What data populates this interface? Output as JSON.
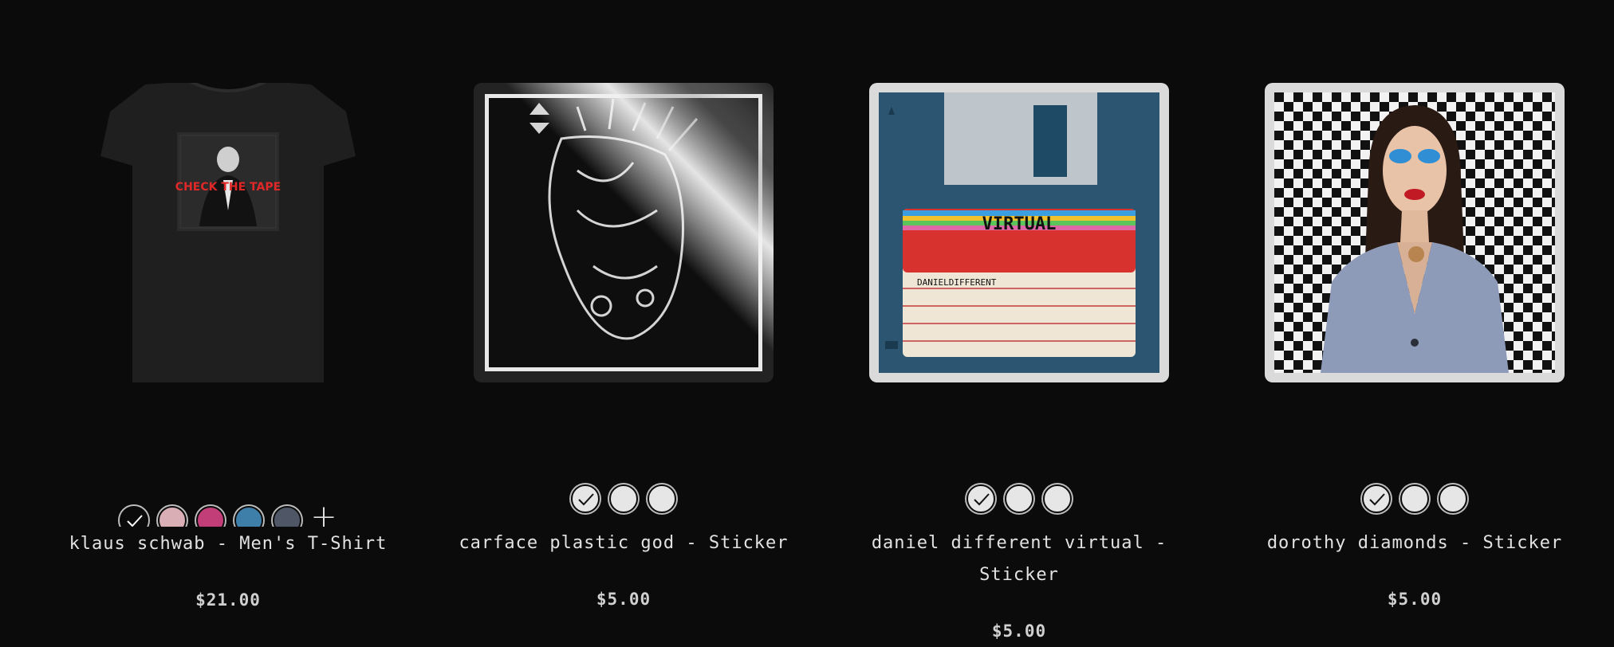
{
  "products": [
    {
      "title": "klaus schwab - Men's T-Shirt",
      "price": "$21.00",
      "shirt_print_text": "CHECK THE TAPE",
      "swatches": [
        "#0b0b0b",
        "#d9aeb4",
        "#c23e78",
        "#3e7fa9",
        "#4f5766"
      ],
      "more_colors_symbol": "+"
    },
    {
      "title": "carface plastic god - Sticker",
      "price": "$5.00",
      "swatches": [
        "#e6e6e6",
        "#e6e6e6",
        "#e6e6e6"
      ]
    },
    {
      "title": "daniel different virtual - Sticker",
      "price": "$5.00",
      "label_title": "VIRTUAL",
      "label_line": "DANIELDIFFERENT",
      "swatches": [
        "#e6e6e6",
        "#e6e6e6",
        "#e6e6e6"
      ]
    },
    {
      "title": "dorothy diamonds - Sticker",
      "price": "$5.00",
      "swatches": [
        "#e6e6e6",
        "#e6e6e6",
        "#e6e6e6"
      ]
    }
  ]
}
